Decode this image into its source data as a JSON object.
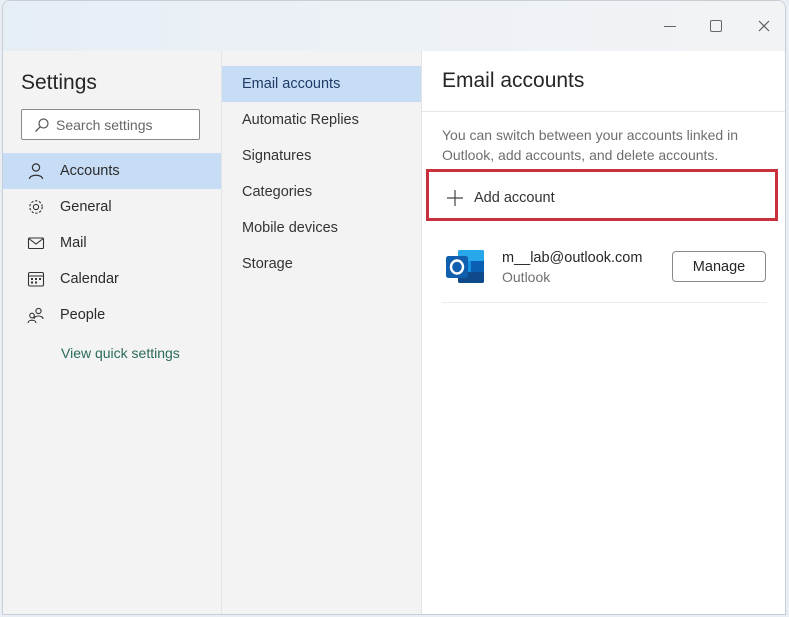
{
  "window": {
    "controls": {
      "minimize": "minimize",
      "maximize": "maximize",
      "close": "close"
    }
  },
  "nav": {
    "title": "Settings",
    "search": {
      "placeholder": "Search settings",
      "value": ""
    },
    "items": [
      {
        "label": "Accounts",
        "icon": "person-icon",
        "active": true
      },
      {
        "label": "General",
        "icon": "gear-icon",
        "active": false
      },
      {
        "label": "Mail",
        "icon": "mail-icon",
        "active": false
      },
      {
        "label": "Calendar",
        "icon": "calendar-icon",
        "active": false
      },
      {
        "label": "People",
        "icon": "people-icon",
        "active": false
      }
    ],
    "quick_settings_link": "View quick settings"
  },
  "subnav": {
    "items": [
      {
        "label": "Email accounts",
        "active": true
      },
      {
        "label": "Automatic Replies",
        "active": false
      },
      {
        "label": "Signatures",
        "active": false
      },
      {
        "label": "Categories",
        "active": false
      },
      {
        "label": "Mobile devices",
        "active": false
      },
      {
        "label": "Storage",
        "active": false
      }
    ]
  },
  "panel": {
    "title": "Email accounts",
    "description": "You can switch between your accounts linked in Outlook, add accounts, and delete accounts.",
    "add_account_label": "Add account",
    "highlight_color": "#c8303b",
    "accounts": [
      {
        "email": "m__lab@outlook.com",
        "type": "Outlook",
        "manage_label": "Manage",
        "icon": "outlook-logo"
      }
    ]
  },
  "colors": {
    "selected_bg": "#c7dcf5",
    "link": "#2a6a5a"
  }
}
